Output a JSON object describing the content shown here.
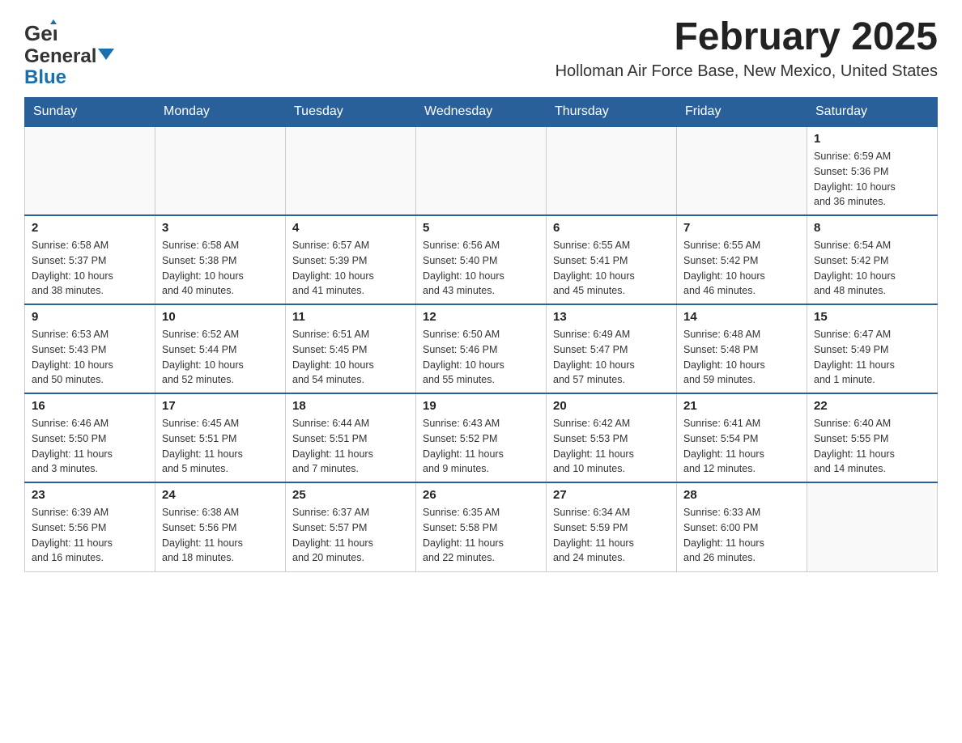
{
  "header": {
    "logo": {
      "general": "General",
      "blue": "Blue",
      "tagline": ""
    },
    "title": "February 2025",
    "subtitle": "Holloman Air Force Base, New Mexico, United States"
  },
  "weekdays": [
    "Sunday",
    "Monday",
    "Tuesday",
    "Wednesday",
    "Thursday",
    "Friday",
    "Saturday"
  ],
  "weeks": [
    [
      {
        "day": "",
        "info": ""
      },
      {
        "day": "",
        "info": ""
      },
      {
        "day": "",
        "info": ""
      },
      {
        "day": "",
        "info": ""
      },
      {
        "day": "",
        "info": ""
      },
      {
        "day": "",
        "info": ""
      },
      {
        "day": "1",
        "info": "Sunrise: 6:59 AM\nSunset: 5:36 PM\nDaylight: 10 hours\nand 36 minutes."
      }
    ],
    [
      {
        "day": "2",
        "info": "Sunrise: 6:58 AM\nSunset: 5:37 PM\nDaylight: 10 hours\nand 38 minutes."
      },
      {
        "day": "3",
        "info": "Sunrise: 6:58 AM\nSunset: 5:38 PM\nDaylight: 10 hours\nand 40 minutes."
      },
      {
        "day": "4",
        "info": "Sunrise: 6:57 AM\nSunset: 5:39 PM\nDaylight: 10 hours\nand 41 minutes."
      },
      {
        "day": "5",
        "info": "Sunrise: 6:56 AM\nSunset: 5:40 PM\nDaylight: 10 hours\nand 43 minutes."
      },
      {
        "day": "6",
        "info": "Sunrise: 6:55 AM\nSunset: 5:41 PM\nDaylight: 10 hours\nand 45 minutes."
      },
      {
        "day": "7",
        "info": "Sunrise: 6:55 AM\nSunset: 5:42 PM\nDaylight: 10 hours\nand 46 minutes."
      },
      {
        "day": "8",
        "info": "Sunrise: 6:54 AM\nSunset: 5:42 PM\nDaylight: 10 hours\nand 48 minutes."
      }
    ],
    [
      {
        "day": "9",
        "info": "Sunrise: 6:53 AM\nSunset: 5:43 PM\nDaylight: 10 hours\nand 50 minutes."
      },
      {
        "day": "10",
        "info": "Sunrise: 6:52 AM\nSunset: 5:44 PM\nDaylight: 10 hours\nand 52 minutes."
      },
      {
        "day": "11",
        "info": "Sunrise: 6:51 AM\nSunset: 5:45 PM\nDaylight: 10 hours\nand 54 minutes."
      },
      {
        "day": "12",
        "info": "Sunrise: 6:50 AM\nSunset: 5:46 PM\nDaylight: 10 hours\nand 55 minutes."
      },
      {
        "day": "13",
        "info": "Sunrise: 6:49 AM\nSunset: 5:47 PM\nDaylight: 10 hours\nand 57 minutes."
      },
      {
        "day": "14",
        "info": "Sunrise: 6:48 AM\nSunset: 5:48 PM\nDaylight: 10 hours\nand 59 minutes."
      },
      {
        "day": "15",
        "info": "Sunrise: 6:47 AM\nSunset: 5:49 PM\nDaylight: 11 hours\nand 1 minute."
      }
    ],
    [
      {
        "day": "16",
        "info": "Sunrise: 6:46 AM\nSunset: 5:50 PM\nDaylight: 11 hours\nand 3 minutes."
      },
      {
        "day": "17",
        "info": "Sunrise: 6:45 AM\nSunset: 5:51 PM\nDaylight: 11 hours\nand 5 minutes."
      },
      {
        "day": "18",
        "info": "Sunrise: 6:44 AM\nSunset: 5:51 PM\nDaylight: 11 hours\nand 7 minutes."
      },
      {
        "day": "19",
        "info": "Sunrise: 6:43 AM\nSunset: 5:52 PM\nDaylight: 11 hours\nand 9 minutes."
      },
      {
        "day": "20",
        "info": "Sunrise: 6:42 AM\nSunset: 5:53 PM\nDaylight: 11 hours\nand 10 minutes."
      },
      {
        "day": "21",
        "info": "Sunrise: 6:41 AM\nSunset: 5:54 PM\nDaylight: 11 hours\nand 12 minutes."
      },
      {
        "day": "22",
        "info": "Sunrise: 6:40 AM\nSunset: 5:55 PM\nDaylight: 11 hours\nand 14 minutes."
      }
    ],
    [
      {
        "day": "23",
        "info": "Sunrise: 6:39 AM\nSunset: 5:56 PM\nDaylight: 11 hours\nand 16 minutes."
      },
      {
        "day": "24",
        "info": "Sunrise: 6:38 AM\nSunset: 5:56 PM\nDaylight: 11 hours\nand 18 minutes."
      },
      {
        "day": "25",
        "info": "Sunrise: 6:37 AM\nSunset: 5:57 PM\nDaylight: 11 hours\nand 20 minutes."
      },
      {
        "day": "26",
        "info": "Sunrise: 6:35 AM\nSunset: 5:58 PM\nDaylight: 11 hours\nand 22 minutes."
      },
      {
        "day": "27",
        "info": "Sunrise: 6:34 AM\nSunset: 5:59 PM\nDaylight: 11 hours\nand 24 minutes."
      },
      {
        "day": "28",
        "info": "Sunrise: 6:33 AM\nSunset: 6:00 PM\nDaylight: 11 hours\nand 26 minutes."
      },
      {
        "day": "",
        "info": ""
      }
    ]
  ]
}
